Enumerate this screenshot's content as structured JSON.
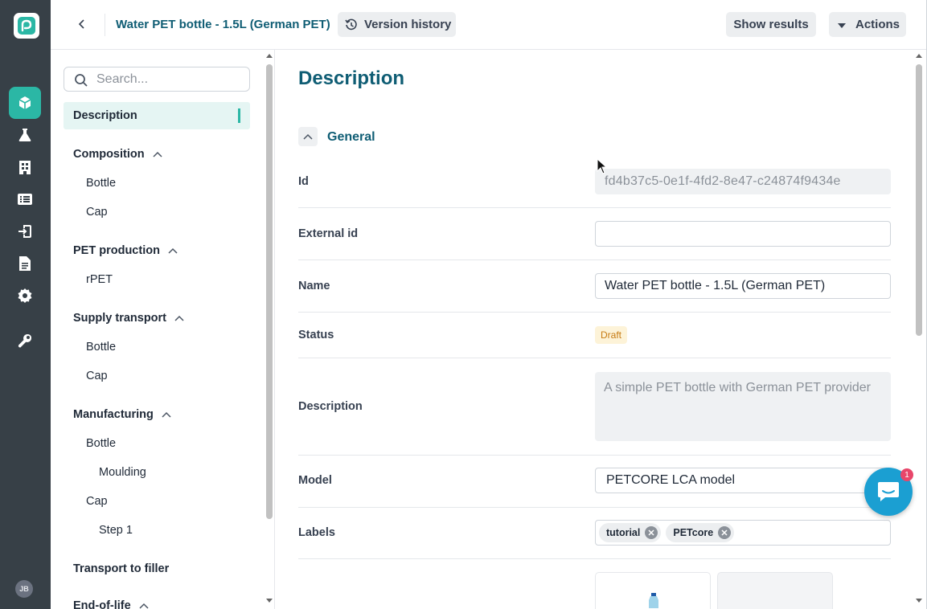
{
  "nav_rail": {
    "items": [
      "logo-icon",
      "cube-icon",
      "flask-icon",
      "building-icon",
      "list-icon",
      "import-icon",
      "document-icon",
      "gear-icon",
      "wrench-icon"
    ],
    "avatar_initials": "JB"
  },
  "header": {
    "title": "Water PET bottle - 1.5L (German PET)",
    "version_history_label": "Version history",
    "show_results_label": "Show results",
    "actions_label": "Actions"
  },
  "sidebar": {
    "search_placeholder": "Search...",
    "items": [
      {
        "label": "Description",
        "level": 0,
        "active": true
      },
      {
        "label": "Composition",
        "level": 0,
        "expanded": true
      },
      {
        "label": "Bottle",
        "level": 1
      },
      {
        "label": "Cap",
        "level": 1
      },
      {
        "label": "PET production",
        "level": 0,
        "expanded": true
      },
      {
        "label": "rPET",
        "level": 1
      },
      {
        "label": "Supply transport",
        "level": 0,
        "expanded": true
      },
      {
        "label": "Bottle",
        "level": 1
      },
      {
        "label": "Cap",
        "level": 1
      },
      {
        "label": "Manufacturing",
        "level": 0,
        "expanded": true
      },
      {
        "label": "Bottle",
        "level": 1
      },
      {
        "label": "Moulding",
        "level": 2
      },
      {
        "label": "Cap",
        "level": 1
      },
      {
        "label": "Step 1",
        "level": 2
      },
      {
        "label": "Transport to filler",
        "level": 0
      },
      {
        "label": "End-of-life",
        "level": 0,
        "expanded": true
      }
    ]
  },
  "main": {
    "page_title": "Description",
    "section_title": "General",
    "fields": {
      "id_label": "Id",
      "id_value": "fd4b37c5-0e1f-4fd2-8e47-c24874f9434e",
      "external_id_label": "External id",
      "external_id_value": "",
      "name_label": "Name",
      "name_value": "Water PET bottle - 1.5L (German PET)",
      "status_label": "Status",
      "status_value": "Draft",
      "description_label": "Description",
      "description_value": "A simple PET bottle with German PET provider",
      "model_label": "Model",
      "model_value": "PETCORE LCA model",
      "labels_label": "Labels",
      "labels": [
        "tutorial",
        "PETcore"
      ]
    }
  },
  "chat": {
    "unread_count": "1"
  },
  "colors": {
    "rail_bg": "#374047",
    "accent": "#2bb7a5",
    "title": "#0f5d74",
    "draft_badge": "#c67a12",
    "chat": "#1b9fd2",
    "chat_badge": "#e8466a"
  }
}
